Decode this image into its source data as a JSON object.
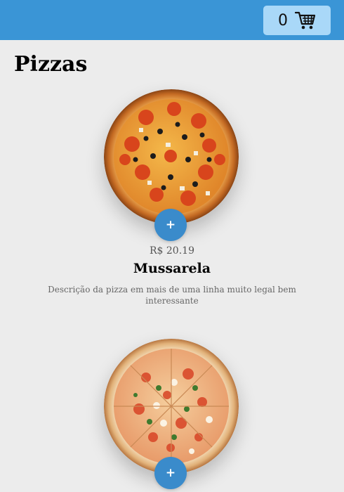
{
  "header": {
    "cart": {
      "count": "0",
      "icon": "shopping-cart-icon"
    }
  },
  "main": {
    "title": "Pizzas",
    "pizzas": [
      {
        "image": "pepperoni-olive-pizza-image",
        "add_label": "+",
        "price": "R$ 20.19",
        "name": "Mussarela",
        "description": "Descrição da pizza em mais de uma linha muito legal bem interessante"
      },
      {
        "image": "mixed-topping-pizza-image",
        "add_label": "+"
      }
    ]
  },
  "colors": {
    "header": "#3a95d6",
    "cart_bg": "#a9d8f8",
    "add_button": "#3a8bcb",
    "page_bg": "#ececec"
  }
}
